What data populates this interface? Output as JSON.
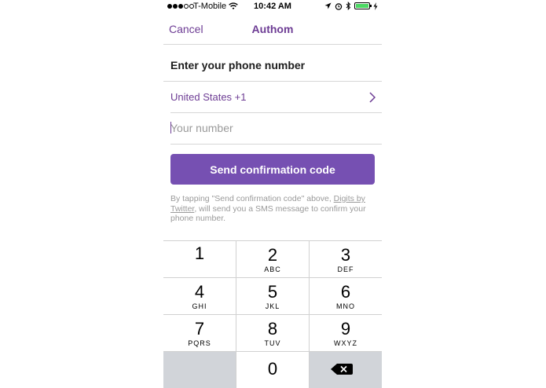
{
  "status_bar": {
    "carrier": "T-Mobile",
    "time": "10:42 AM",
    "icons": [
      "signal-dots-icon",
      "wifi-icon",
      "location-arrow-icon",
      "alarm-icon",
      "bluetooth-icon",
      "battery-icon",
      "charging-bolt-icon"
    ],
    "battery_color": "#4cd964"
  },
  "nav": {
    "cancel_label": "Cancel",
    "title": "Authom"
  },
  "form": {
    "heading": "Enter your phone number",
    "country": "United States +1",
    "number_placeholder": "Your number",
    "number_value": "",
    "send_label": "Send confirmation code",
    "disclaimer_prefix": "By tapping \"Send confirmation code\" above, ",
    "disclaimer_link": "Digits by Twitter",
    "disclaimer_suffix": ", will send you a SMS message to confirm your phone number."
  },
  "keypad": {
    "keys": [
      {
        "digit": "1",
        "letters": ""
      },
      {
        "digit": "2",
        "letters": "ABC"
      },
      {
        "digit": "3",
        "letters": "DEF"
      },
      {
        "digit": "4",
        "letters": "GHI"
      },
      {
        "digit": "5",
        "letters": "JKL"
      },
      {
        "digit": "6",
        "letters": "MNO"
      },
      {
        "digit": "7",
        "letters": "PQRS"
      },
      {
        "digit": "8",
        "letters": "TUV"
      },
      {
        "digit": "9",
        "letters": "WXYZ"
      },
      {
        "digit": "0",
        "letters": ""
      }
    ]
  },
  "colors": {
    "accent": "#6d3c94",
    "button": "#7650b2",
    "keypad_grey": "#d1d4d9"
  }
}
